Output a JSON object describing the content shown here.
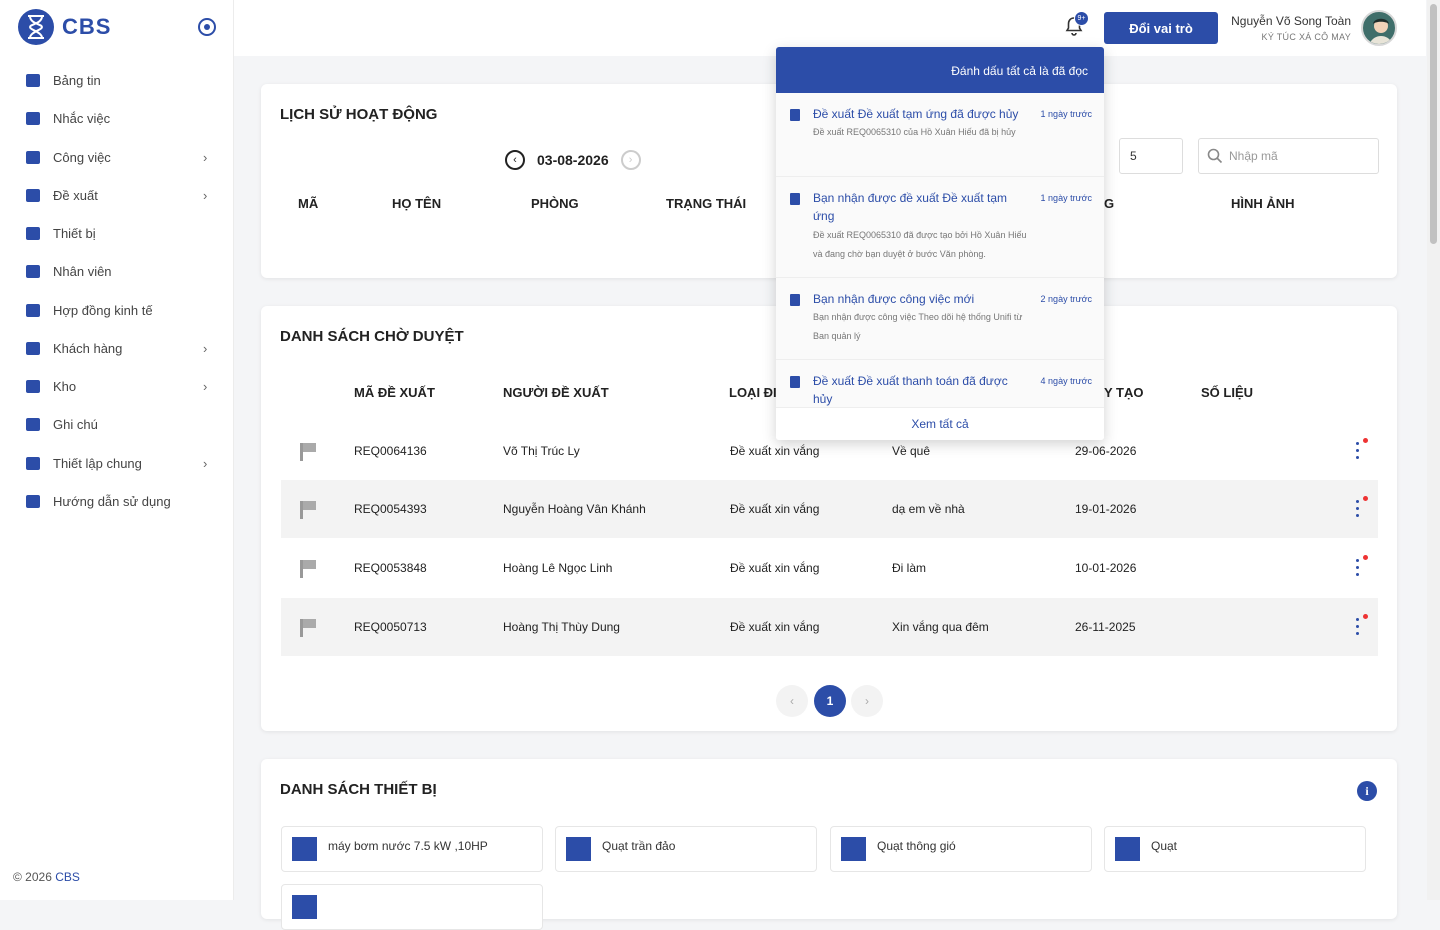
{
  "brand": {
    "name": "CBS"
  },
  "sidebar": {
    "items": [
      {
        "label": "Bảng tin",
        "icon": "news-icon",
        "chevron": false
      },
      {
        "label": "Nhắc việc",
        "icon": "megaphone-icon",
        "chevron": false
      },
      {
        "label": "Công việc",
        "icon": "briefcase-icon",
        "chevron": true
      },
      {
        "label": "Đề xuất",
        "icon": "document-icon",
        "chevron": true
      },
      {
        "label": "Thiết bị",
        "icon": "device-icon",
        "chevron": false
      },
      {
        "label": "Nhân viên",
        "icon": "users-icon",
        "chevron": false
      },
      {
        "label": "Hợp đồng kinh tế",
        "icon": "contract-icon",
        "chevron": false
      },
      {
        "label": "Khách hàng",
        "icon": "customer-icon",
        "chevron": true
      },
      {
        "label": "Kho",
        "icon": "warehouse-icon",
        "chevron": true
      },
      {
        "label": "Ghi chú",
        "icon": "note-icon",
        "chevron": false
      },
      {
        "label": "Thiết lập chung",
        "icon": "gear-icon",
        "chevron": true
      },
      {
        "label": "Hướng dẫn sử dụng",
        "icon": "guide-icon",
        "chevron": false
      }
    ],
    "copyright_prefix": "© 2026",
    "copyright_brand": "CBS"
  },
  "header": {
    "badge": "9+",
    "role_button": "Đổi vai trò",
    "user_name": "Nguyễn Võ Song Toàn",
    "user_role": "KÝ TÚC XÁ CÔ MAY"
  },
  "history": {
    "title": "LỊCH SỬ HOẠT ĐỘNG",
    "date": "03-08-2026",
    "page_size": "5",
    "search_placeholder": "Nhập mã",
    "columns": [
      "MÃ",
      "HỌ TÊN",
      "PHÒNG",
      "TRẠNG THÁI",
      "G",
      "HÌNH ẢNH"
    ]
  },
  "pending": {
    "title": "DANH SÁCH CHỜ DUYỆT",
    "columns": [
      "MÃ ĐỀ XUẤT",
      "NGƯỜI ĐỀ XUẤT",
      "LOẠI ĐI",
      "Y TẠO",
      "SỐ LIỆU"
    ],
    "rows": [
      {
        "code": "REQ0064136",
        "person": "Võ Thị Trúc Ly",
        "type": "Đề xuất xin vắng",
        "reason": "Về quê",
        "date": "29-06-2026"
      },
      {
        "code": "REQ0054393",
        "person": "Nguyễn Hoàng Vân Khánh",
        "type": "Đề xuất xin vắng",
        "reason": "dạ em về nhà",
        "date": "19-01-2026"
      },
      {
        "code": "REQ0053848",
        "person": "Hoàng Lê Ngọc Linh",
        "type": "Đề xuất xin vắng",
        "reason": "Đi làm",
        "date": "10-01-2026"
      },
      {
        "code": "REQ0050713",
        "person": "Hoàng Thị Thùy Dung",
        "type": "Đề xuất xin vắng",
        "reason": "Xin vắng qua đêm",
        "date": "26-11-2025"
      }
    ],
    "page": "1",
    "prev": "‹",
    "next": "›"
  },
  "devices": {
    "title": "DANH SÁCH THIẾT BỊ",
    "info": "i",
    "items": [
      "máy bơm nước 7.5 kW ,10HP",
      "Quạt trần đảo",
      "Quạt thông gió",
      "Quạt"
    ]
  },
  "notifications": {
    "mark_all": "Đánh dấu tất cả là đã đọc",
    "view_all": "Xem tất cả",
    "items": [
      {
        "title": "Đề xuất Đề xuất tạm ứng đã được hủy",
        "desc": "Đề xuất REQ0065310 của Hồ Xuân Hiếu đã bị hủy",
        "time": "1 ngày trước"
      },
      {
        "title": "Bạn nhận được đề xuất Đề xuất tạm ứng",
        "desc": "Đề xuất REQ0065310 đã được tạo bởi Hồ Xuân Hiếu và đang chờ bạn duyệt ở bước Văn phòng.",
        "time": "1 ngày trước"
      },
      {
        "title": "Bạn nhận được công việc mới",
        "desc": "Bạn nhận được công việc Theo dõi hệ thống Unifi từ Ban quản lý",
        "time": "2 ngày trước"
      },
      {
        "title": "Đề xuất Đề xuất thanh toán đã được hủy",
        "desc": "",
        "time": "4 ngày trước"
      }
    ]
  }
}
